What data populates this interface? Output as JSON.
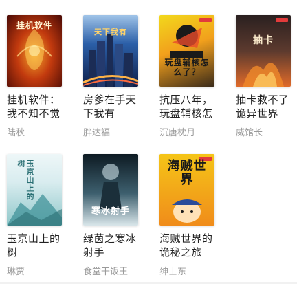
{
  "books": [
    {
      "title": "挂机软件：我不知不觉",
      "author": "陆秋",
      "cover_text": "挂机软件",
      "cover_colors": [
        "#4a0a05",
        "#c23a0e",
        "#f3a32b"
      ]
    },
    {
      "title": "房爹在手天下我有",
      "author": "胖达福",
      "cover_text": "天下我有",
      "cover_colors": [
        "#0e1f4a",
        "#2b5fa8",
        "#e7a94a"
      ]
    },
    {
      "title": "抗压八年，玩盘辅核怎",
      "author": "沉唐枕月",
      "cover_text": "玩盘辅核怎么了？",
      "cover_colors": [
        "#f2d81c",
        "#1a1a1a",
        "#e84b2a"
      ]
    },
    {
      "title": "抽卡救不了诡异世界",
      "author": "威馆长",
      "cover_text": "抽卡",
      "cover_colors": [
        "#2a2020",
        "#5c3a2e",
        "#e06a2a"
      ]
    },
    {
      "title": "玉京山上的树",
      "author": "琳贾",
      "cover_text": "玉京山上的树",
      "cover_colors": [
        "#d8ecef",
        "#8fc7c9",
        "#3a8f95"
      ]
    },
    {
      "title": "绿茵之寒冰射手",
      "author": "食堂干饭王",
      "cover_text": "寒冰射手",
      "cover_colors": [
        "#0d1a22",
        "#3d5f6e",
        "#d9e6ea"
      ]
    },
    {
      "title": "海贼世界的诡秘之旅",
      "author": "绅士东",
      "cover_text": "海贼世界",
      "cover_colors": [
        "#f5c518",
        "#f08c1a",
        "#2a4c9a"
      ]
    }
  ]
}
